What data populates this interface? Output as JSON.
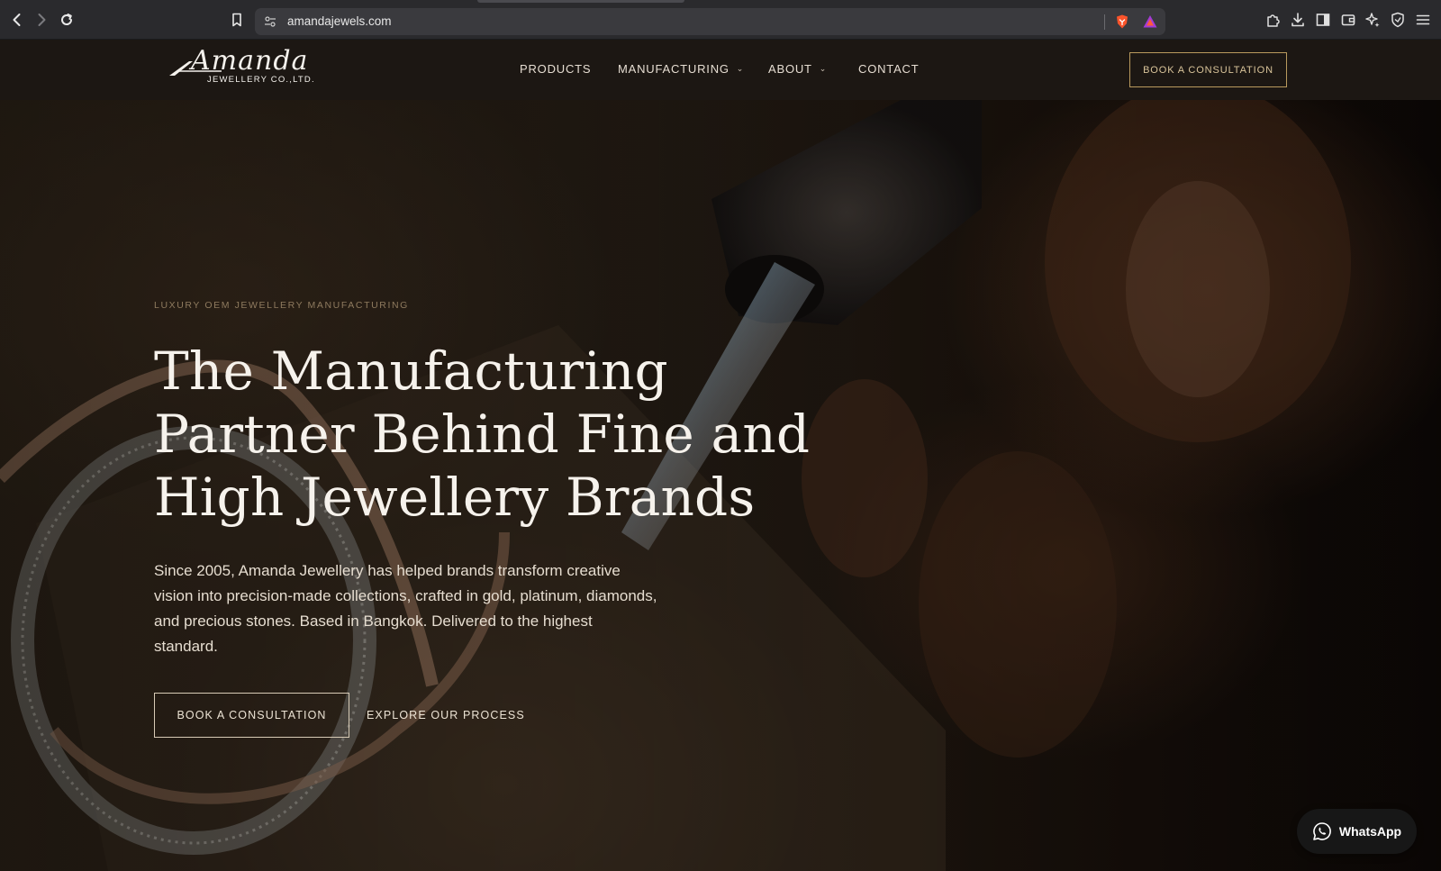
{
  "browser": {
    "url": "amandajewels.com",
    "icons": [
      "back-icon",
      "forward-icon",
      "reload-icon",
      "bookmark-icon",
      "site-settings-icon",
      "brave-shields-icon",
      "brave-rewards-icon",
      "extensions-icon",
      "downloads-icon",
      "sidebar-icon",
      "wallet-icon",
      "leo-ai-icon",
      "vpn-icon",
      "menu-icon"
    ]
  },
  "header": {
    "logo_script": "Amanda",
    "logo_sub": "JEWELLERY CO.,LTD.",
    "nav": [
      {
        "label": "PRODUCTS",
        "has_dropdown": false
      },
      {
        "label": "MANUFACTURING",
        "has_dropdown": true
      },
      {
        "label": "ABOUT",
        "has_dropdown": true
      },
      {
        "label": "CONTACT",
        "has_dropdown": false
      }
    ],
    "cta_label": "BOOK A CONSULTATION"
  },
  "hero": {
    "eyebrow": "LUXURY OEM JEWELLERY MANUFACTURING",
    "headline": "The Manufacturing Partner Behind Fine and High Jewellery Brands",
    "intro": "Since 2005, Amanda Jewellery has helped brands transform creative vision into precision-made collections, crafted in gold, platinum, diamonds, and precious stones. Based in Bangkok. Delivered to the highest standard.",
    "primary_cta": "BOOK A CONSULTATION",
    "secondary_cta": "EXPLORE OUR PROCESS"
  },
  "whatsapp": {
    "label": "WhatsApp"
  },
  "colors": {
    "header_bg": "#1c1713",
    "accent_gold": "#b99a5d",
    "whatsapp_bg": "#171717"
  }
}
